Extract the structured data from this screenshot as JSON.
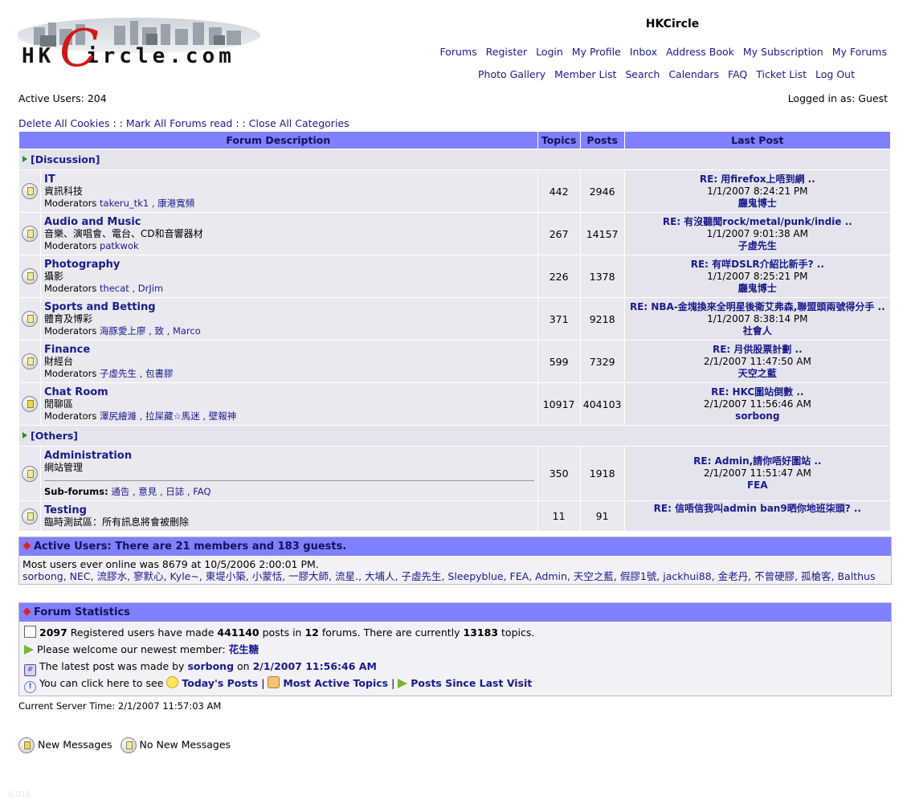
{
  "header": {
    "logo_text": "HKCircle.com",
    "site_title": "HKCircle",
    "nav_row1": [
      "Forums",
      "Register",
      "Login",
      "My Profile",
      "Inbox",
      "Address Book",
      "My Subscription",
      "My Forums"
    ],
    "nav_row2": [
      "Photo Gallery",
      "Member List",
      "Search",
      "Calendars",
      "FAQ",
      "Ticket List",
      "Log Out"
    ]
  },
  "status": {
    "active_users": "Active Users: 204",
    "logged_in": "Logged in as: Guest"
  },
  "commands": [
    "Delete All Cookies",
    "Mark All Forums read",
    "Close All Categories"
  ],
  "commands_sep": ": :",
  "table": {
    "headers": [
      "Forum Description",
      "Topics",
      "Posts",
      "Last Post"
    ],
    "categories": [
      {
        "name": "[Discussion]",
        "forums": [
          {
            "name": "IT",
            "desc": "資訊科技",
            "mods_label": "Moderators",
            "mods": "takeru_tk1 , 康港寬頻",
            "topics": "442",
            "posts": "2946",
            "lp_title": "RE: 用firefox上唔到網 ..",
            "lp_date": "1/1/2007 8:24:21 PM",
            "lp_user": "廳鬼博士"
          },
          {
            "name": "Audio and Music",
            "desc": "音樂、演唱會、電台、CD和音響器材",
            "mods_label": "Moderators",
            "mods": "patkwok",
            "topics": "267",
            "posts": "14157",
            "lp_title": "RE: 有沒聽聞rock/metal/punk/indie ..",
            "lp_date": "1/1/2007 9:01:38 AM",
            "lp_user": "子虛先生"
          },
          {
            "name": "Photography",
            "desc": "攝影",
            "mods_label": "Moderators",
            "mods": "thecat , DrJim",
            "topics": "226",
            "posts": "1378",
            "lp_title": "RE: 有咩DSLR介紹比新手? ..",
            "lp_date": "1/1/2007 8:25:21 PM",
            "lp_user": "廳鬼博士"
          },
          {
            "name": "Sports and Betting",
            "desc": "體育及博彩",
            "mods_label": "Moderators",
            "mods": "海豚愛上廖 , 致 , Marco",
            "topics": "371",
            "posts": "9218",
            "lp_title": "RE: NBA-金塊換來全明星後衛艾弗森,聯盟頭兩號得分手 ..",
            "lp_date": "1/1/2007 8:38:14 PM",
            "lp_user": "社會人"
          },
          {
            "name": "Finance",
            "desc": "財經台",
            "mods_label": "Moderators",
            "mods": "子虛先生 , 包書膠",
            "topics": "599",
            "posts": "7329",
            "lp_title": "RE: 月供股票計劃 ..",
            "lp_date": "2/1/2007 11:47:50 AM",
            "lp_user": "天空之藍"
          },
          {
            "name": "Chat Room",
            "desc": "閒聊區",
            "mods_label": "Moderators",
            "mods": "澤尻繪濰 , 拉屎藏☆馬迷 , 壁報神",
            "topics": "10917",
            "posts": "404103",
            "lp_title": "RE: HKC圍站倒數 ..",
            "lp_date": "2/1/2007 11:56:46 AM",
            "lp_user": "sorbong"
          }
        ]
      },
      {
        "name": "[Others]",
        "forums": [
          {
            "name": "Administration",
            "desc": "網站管理",
            "sub_label": "Sub-forums:",
            "subs": "通告 , 意見 , 日誌 , FAQ",
            "topics": "350",
            "posts": "1918",
            "lp_title": "RE: Admin,請你唔好圍站 ..",
            "lp_date": "2/1/2007 11:51:47 AM",
            "lp_user": "FEA"
          },
          {
            "name": "Testing",
            "desc": "臨時測試區：所有訊息將會被刪除",
            "topics": "11",
            "posts": "91",
            "lp_title": "RE: 信唔信我叫admin ban9晒你地班柒頭? ..",
            "lp_date": "",
            "lp_user": ""
          }
        ]
      }
    ]
  },
  "active_users_box": {
    "title": "Active Users: There are 21 members and 183 guests.",
    "most_online": "Most users ever online was 8679 at 10/5/2006 2:00:01 PM.",
    "members": "sorbong, NEC, 流膠水, 寥默心, Kyle~, 東堤小築, 小蒙恬, 一膠大師, 流星., 大埔人, 子虛先生, Sleepyblue, FEA, Admin, 天空之藍, 假膠1號, jackhui88, 金老丹, 不曾硬膠, 孤槍客, Balthus"
  },
  "stats_box": {
    "title": "Forum Statistics",
    "users_count": "2097",
    "t1": "Registered users have made",
    "posts_count": "441140",
    "t2": "posts in",
    "forums_count": "12",
    "t3": "forums. There are currently",
    "topics_count": "13183",
    "t4": "topics.",
    "welcome_text": "Please welcome our newest member:",
    "newest_member": "花生糖",
    "latest_text": "The latest post was made by",
    "latest_user": "sorbong",
    "latest_on": "on",
    "latest_date": "2/1/2007 11:56:46 AM",
    "click_text": "You can click here to see",
    "todays_posts": "Today's Posts",
    "most_active": "Most Active Topics",
    "since_last": "Posts Since Last Visit",
    "sep": "|"
  },
  "server_time": "Current Server Time: 2/1/2007 11:57:03 AM",
  "legend": {
    "new": "New Messages",
    "none": "No New Messages"
  },
  "corner_text": "0.016",
  "icons": [
    "forum-folder-icon",
    "category-arrow-icon",
    "red-diamond-icon",
    "doc-icon",
    "arrow-right-icon",
    "hash-icon",
    "info-icon",
    "lightbulb-icon",
    "thumbs-up-icon"
  ],
  "colors": {
    "header_bg": "#8080ff",
    "row_bg": "#e9e9ef",
    "link": "#1a1a8c"
  }
}
